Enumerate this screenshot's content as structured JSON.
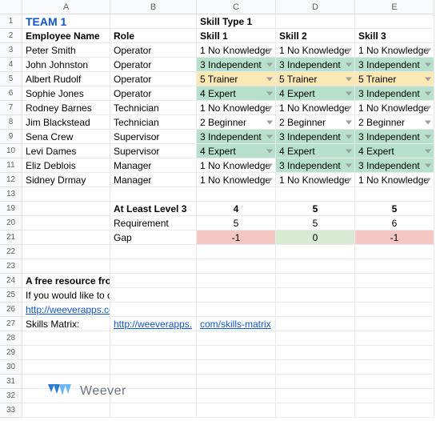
{
  "columns": [
    "A",
    "B",
    "C",
    "D",
    "E"
  ],
  "row_headers": [
    "1",
    "2",
    "3",
    "4",
    "5",
    "6",
    "7",
    "8",
    "9",
    "10",
    "11",
    "12",
    "13",
    "19",
    "20",
    "21",
    "22",
    "23",
    "24",
    "25",
    "26",
    "27",
    "28",
    "29",
    "30",
    "31",
    "32",
    "33"
  ],
  "team_label": "TEAM 1",
  "skill_type_label": "Skill Type 1",
  "headers": {
    "employee": "Employee Name",
    "role": "Role",
    "s1": "Skill 1",
    "s2": "Skill 2",
    "s3": "Skill 3"
  },
  "skill_levels": {
    "l1": "1 No Knowledge",
    "l2": "2 Beginner",
    "l3": "3 Independent",
    "l4": "4 Expert",
    "l5": "5 Trainer"
  },
  "rows": [
    {
      "name": "Peter Smith",
      "role": "Operator",
      "s1": "l1",
      "s2": "l1",
      "s3": "l1"
    },
    {
      "name": "John Johnston",
      "role": "Operator",
      "s1": "l3",
      "s2": "l3",
      "s3": "l3"
    },
    {
      "name": "Albert Rudolf",
      "role": "Operator",
      "s1": "l5",
      "s2": "l5",
      "s3": "l5"
    },
    {
      "name": "Sophie Jones",
      "role": "Operator",
      "s1": "l4",
      "s2": "l4",
      "s3": "l3"
    },
    {
      "name": "Rodney Barnes",
      "role": "Technician",
      "s1": "l1",
      "s2": "l1",
      "s3": "l1"
    },
    {
      "name": "Jim Blackstead",
      "role": "Technician",
      "s1": "l2",
      "s2": "l2",
      "s3": "l2"
    },
    {
      "name": "Sena Crew",
      "role": "Supervisor",
      "s1": "l3",
      "s2": "l3",
      "s3": "l3"
    },
    {
      "name": "Levi Dames",
      "role": "Supervisor",
      "s1": "l4",
      "s2": "l4",
      "s3": "l4"
    },
    {
      "name": "Eliz Deblois",
      "role": "Manager",
      "s1": "l1",
      "s2": "l3",
      "s3": "l3"
    },
    {
      "name": "Sidney Drmay",
      "role": "Manager",
      "s1": "l1",
      "s2": "l1",
      "s3": "l1"
    }
  ],
  "summary": {
    "at_least_label": "At Least Level 3",
    "at_least": {
      "s1": "4",
      "s2": "5",
      "s3": "5"
    },
    "req_label": "Requirement",
    "req": {
      "s1": "5",
      "s2": "5",
      "s3": "6"
    },
    "gap_label": "Gap",
    "gap": {
      "s1": "-1",
      "s2": "0",
      "s3": "-1"
    }
  },
  "footer": {
    "resource_line": "A free resource from Weever",
    "digitize_line": "If you would like to digitize this an other processes, feel free to learn more about Weever at:",
    "url1": "http://weeverapps.com",
    "matrix_label": "Skills Matrix:",
    "url2_a": "http://weeverapps.",
    "url2_b": "com/skills-matrix"
  },
  "brand": "Weever",
  "chart_data": {
    "type": "table",
    "columns": [
      "Employee Name",
      "Role",
      "Skill 1",
      "Skill 2",
      "Skill 3"
    ],
    "rows": [
      [
        "Peter Smith",
        "Operator",
        "1 No Knowledge",
        "1 No Knowledge",
        "1 No Knowledge"
      ],
      [
        "John Johnston",
        "Operator",
        "3 Independent",
        "3 Independent",
        "3 Independent"
      ],
      [
        "Albert Rudolf",
        "Operator",
        "5 Trainer",
        "5 Trainer",
        "5 Trainer"
      ],
      [
        "Sophie Jones",
        "Operator",
        "4 Expert",
        "4 Expert",
        "3 Independent"
      ],
      [
        "Rodney Barnes",
        "Technician",
        "1 No Knowledge",
        "1 No Knowledge",
        "1 No Knowledge"
      ],
      [
        "Jim Blackstead",
        "Technician",
        "2 Beginner",
        "2 Beginner",
        "2 Beginner"
      ],
      [
        "Sena Crew",
        "Supervisor",
        "3 Independent",
        "3 Independent",
        "3 Independent"
      ],
      [
        "Levi Dames",
        "Supervisor",
        "4 Expert",
        "4 Expert",
        "4 Expert"
      ],
      [
        "Eliz Deblois",
        "Manager",
        "1 No Knowledge",
        "3 Independent",
        "3 Independent"
      ],
      [
        "Sidney Drmay",
        "Manager",
        "1 No Knowledge",
        "1 No Knowledge",
        "1 No Knowledge"
      ]
    ],
    "summary": {
      "At Least Level 3": [
        4,
        5,
        5
      ],
      "Requirement": [
        5,
        5,
        6
      ],
      "Gap": [
        -1,
        0,
        -1
      ]
    }
  }
}
